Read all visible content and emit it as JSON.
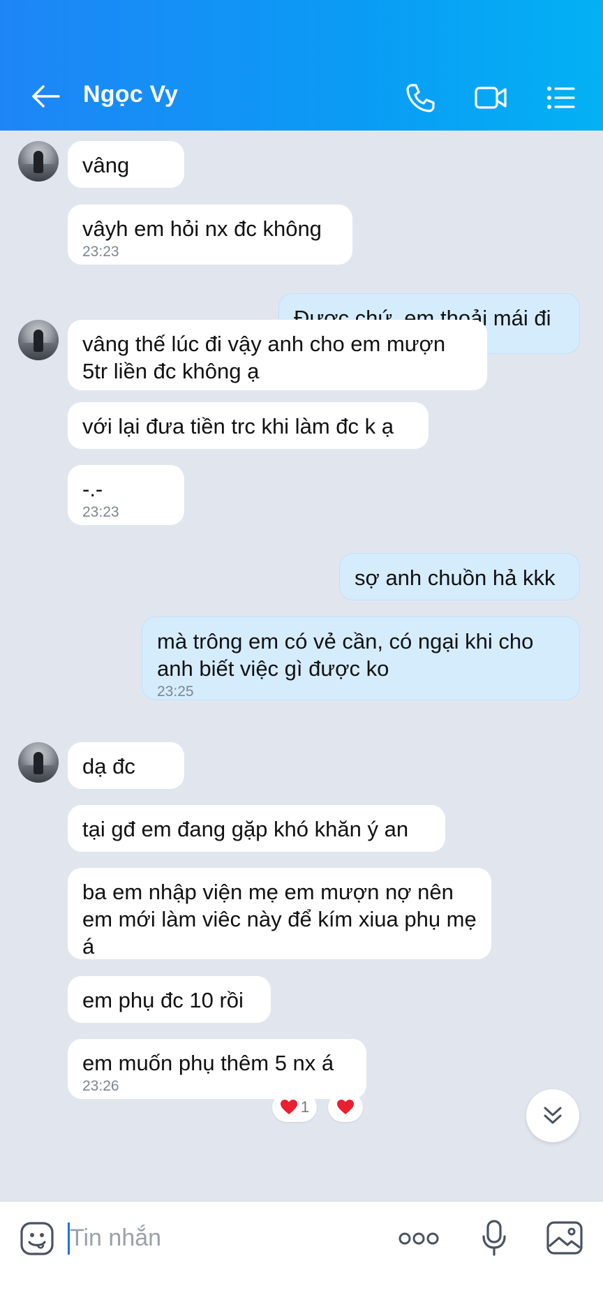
{
  "header": {
    "contact_name": "Ngọc Vy",
    "icons": [
      "back-arrow-icon",
      "phone-icon",
      "video-call-icon",
      "list-menu-icon"
    ]
  },
  "messages": [
    {
      "side": "in",
      "text": "vâng",
      "time": ""
    },
    {
      "side": "in",
      "text": "vâyh em hỏi nx đc không",
      "time": "23:23"
    },
    {
      "side": "out",
      "text": "Được chứ, em thoải mái đi",
      "time": "23:23"
    },
    {
      "side": "in",
      "text": "vâng thế lúc đi vậy anh cho em mượn 5tr liền đc không ạ",
      "time": ""
    },
    {
      "side": "in",
      "text": "với lại đưa tiền trc khi làm đc k ạ",
      "time": ""
    },
    {
      "side": "in",
      "text": "-.-",
      "time": "23:23"
    },
    {
      "side": "out",
      "text": "sợ anh chuồn hả kkk",
      "time": ""
    },
    {
      "side": "out",
      "text": "mà trông em có vẻ cần, có ngại khi cho anh biết việc gì được ko",
      "time": "23:25"
    },
    {
      "side": "in",
      "text": "dạ đc",
      "time": ""
    },
    {
      "side": "in",
      "text": "tại gđ em đang gặp khó khăn ý an",
      "time": ""
    },
    {
      "side": "in",
      "text": "ba em nhập viện mẹ em mượn nợ nên em mới làm viêc này để kím xiua phụ mẹ á",
      "time": ""
    },
    {
      "side": "in",
      "text": "em phụ đc 10 rồi",
      "time": ""
    },
    {
      "side": "in",
      "text": "em muốn phụ thêm 5 nx á",
      "time": "23:26"
    }
  ],
  "reactions": {
    "heart_count": "1",
    "icons": [
      "heart-icon"
    ]
  },
  "input": {
    "placeholder": "Tin nhắn",
    "icons": [
      "sticker-icon",
      "more-icon",
      "microphone-icon",
      "image-icon"
    ]
  },
  "colors": {
    "header_start": "#1e85f6",
    "header_end": "#03b1f4",
    "chat_bg": "#e1e6ee",
    "incoming_bubble": "#ffffff",
    "outgoing_bubble": "#d5ecfd",
    "heart": "#e8202f"
  }
}
